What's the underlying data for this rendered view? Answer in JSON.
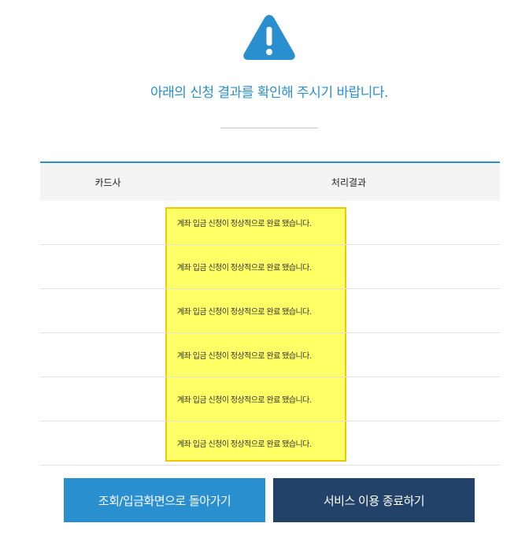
{
  "heading": "아래의 신청 결과를 확인해 주시기 바랍니다.",
  "icon": "warning-icon",
  "colors": {
    "accent": "#2a8fcf",
    "dark_button": "#22426a",
    "highlight": "#ffff66",
    "highlight_border": "#f0c808"
  },
  "table": {
    "headers": {
      "card": "카드사",
      "result": "처리결과"
    },
    "rows": [
      {
        "card": "",
        "result": "계좌 입금 신청이 정상적으로 완료 됐습니다."
      },
      {
        "card": "",
        "result": "계좌 입금 신청이 정상적으로 완료 됐습니다."
      },
      {
        "card": "",
        "result": "계좌 입금 신청이 정상적으로 완료 됐습니다."
      },
      {
        "card": "",
        "result": "계좌 입금 신청이 정상적으로 완료 됐습니다."
      },
      {
        "card": "",
        "result": "계좌 입금 신청이 정상적으로 완료 됐습니다."
      },
      {
        "card": "",
        "result": "계좌 입금 신청이 정상적으로 완료 됐습니다."
      }
    ]
  },
  "buttons": {
    "back_label": "조회/입금화면으로 돌아가기",
    "exit_label": "서비스 이용 종료하기"
  }
}
